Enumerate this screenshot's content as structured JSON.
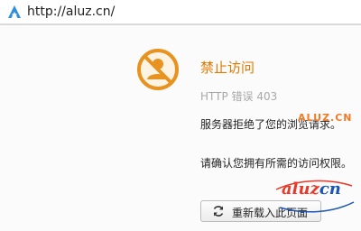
{
  "browser": {
    "url": "http://aluz.cn/",
    "favicon": "aluz-a-icon"
  },
  "error": {
    "icon": "blocked-user-icon",
    "title": "禁止访问",
    "code": "HTTP 错误 403",
    "message_1": "服务器拒绝了您的浏览请求。",
    "message_2": "请确认您拥有所需的访问权限。",
    "reload_label": "重新载入此页面",
    "reload_icon": "refresh-icon"
  },
  "watermark": {
    "text_1": "ALUZ.CN",
    "text_2_left": "aluz",
    "text_2_right": "cn"
  },
  "colors": {
    "accent": "#e8921f",
    "title": "#e07b00",
    "watermark_orange": "#f27a28",
    "watermark_red": "#e8392a",
    "watermark_blue": "#1a56b8"
  }
}
